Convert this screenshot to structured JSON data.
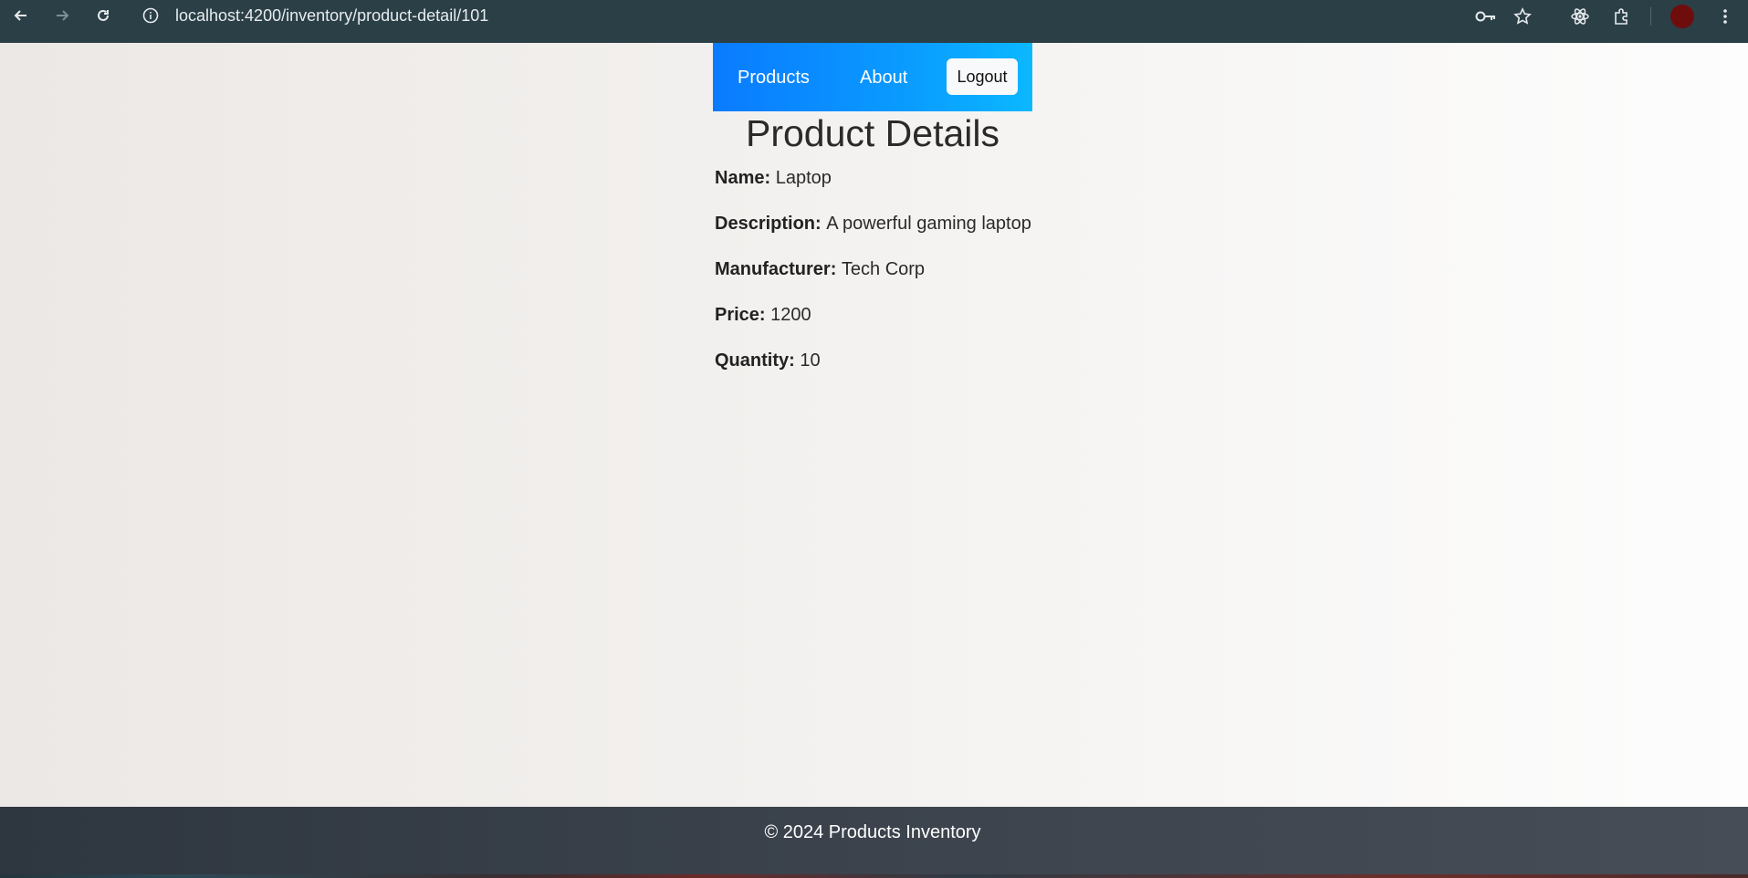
{
  "browser": {
    "url": "localhost:4200/inventory/product-detail/101",
    "icons": [
      "back-icon",
      "forward-icon",
      "reload-icon",
      "info-icon",
      "key-icon",
      "star-icon",
      "react-icon",
      "extensions-icon",
      "menu-icon"
    ]
  },
  "navbar": {
    "products_label": "Products",
    "about_label": "About",
    "logout_label": "Logout",
    "accent_color": "#0a8cff"
  },
  "page": {
    "title": "Product Details"
  },
  "product": {
    "name_label": "Name:",
    "name": "Laptop",
    "description_label": "Description:",
    "description": "A powerful gaming laptop",
    "manufacturer_label": "Manufacturer:",
    "manufacturer": "Tech Corp",
    "price_label": "Price:",
    "price": "1200",
    "quantity_label": "Quantity:",
    "quantity": "10"
  },
  "footer": {
    "text": "© 2024 Products Inventory"
  }
}
